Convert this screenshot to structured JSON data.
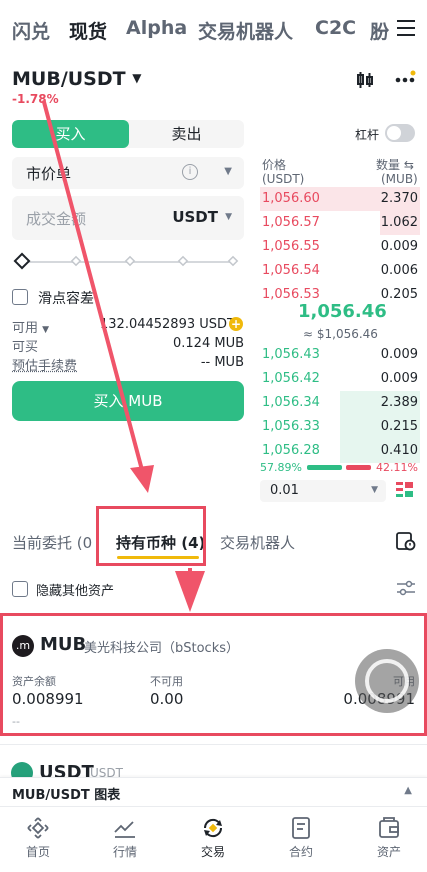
{
  "top_tabs": [
    "闪兑",
    "现货",
    "Alpha",
    "交易机器人",
    "C2C",
    "肦"
  ],
  "active_tab": "现货",
  "pair": {
    "symbol": "MUB/USDT",
    "change": "-1.78%"
  },
  "order_form": {
    "buy_label": "买入",
    "sell_label": "卖出",
    "leverage_label": "杠杆",
    "order_type": "市价单",
    "amount_placeholder": "成交金额",
    "amount_unit": "USDT",
    "slippage_label": "滑点容差",
    "available_label": "可用",
    "available_value": "132.04452893 USDT",
    "can_buy_label": "可买",
    "can_buy_value": "0.124 MUB",
    "fee_label": "预估手续费",
    "fee_value": "-- MUB",
    "submit_label": "买入 MUB"
  },
  "order_book": {
    "price_header": "价格",
    "price_unit": "(USDT)",
    "qty_header": "数量",
    "qty_unit": "(MUB)",
    "asks": [
      {
        "price": "1,056.60",
        "qty": "2.370",
        "depth": 1.0
      },
      {
        "price": "1,056.57",
        "qty": "1.062",
        "depth": 0.25
      },
      {
        "price": "1,056.55",
        "qty": "0.009",
        "depth": 0
      },
      {
        "price": "1,056.54",
        "qty": "0.006",
        "depth": 0
      },
      {
        "price": "1,056.53",
        "qty": "0.205",
        "depth": 0
      }
    ],
    "last_price": "1,056.46",
    "last_price_usd": "≈ $1,056.46",
    "bids": [
      {
        "price": "1,056.43",
        "qty": "0.009",
        "depth": 0
      },
      {
        "price": "1,056.42",
        "qty": "0.009",
        "depth": 0
      },
      {
        "price": "1,056.34",
        "qty": "2.389",
        "depth": 0.5
      },
      {
        "price": "1,056.33",
        "qty": "0.215",
        "depth": 0.5
      },
      {
        "price": "1,056.28",
        "qty": "0.410",
        "depth": 0.5
      }
    ],
    "buy_ratio": "57.89%",
    "sell_ratio": "42.11%",
    "buy_ratio_value": 57.89,
    "precision": "0.01"
  },
  "lower_tabs": {
    "open_orders": "当前委托 (0",
    "holdings": "持有币种 (4)",
    "bots": "交易机器人"
  },
  "hide_other_label": "隐藏其他资产",
  "holding": {
    "symbol": "MUB",
    "name": "美光科技公司（bStocks）",
    "balance_label": "资产余额",
    "balance_value": "0.008991",
    "unavailable_label": "不可用",
    "unavailable_value": "0.00",
    "available_label": "可用",
    "available_value": "0.008991",
    "footnote": "--"
  },
  "next_holding": {
    "symbol": "USDT",
    "name": "USDT"
  },
  "chart_bar_label": "MUB/USDT 图表",
  "bottom_nav": [
    "首页",
    "行情",
    "交易",
    "合约",
    "资产"
  ],
  "colors": {
    "green": "#2ebd85",
    "red": "#e84a5f",
    "annotation": "#f0556a"
  }
}
